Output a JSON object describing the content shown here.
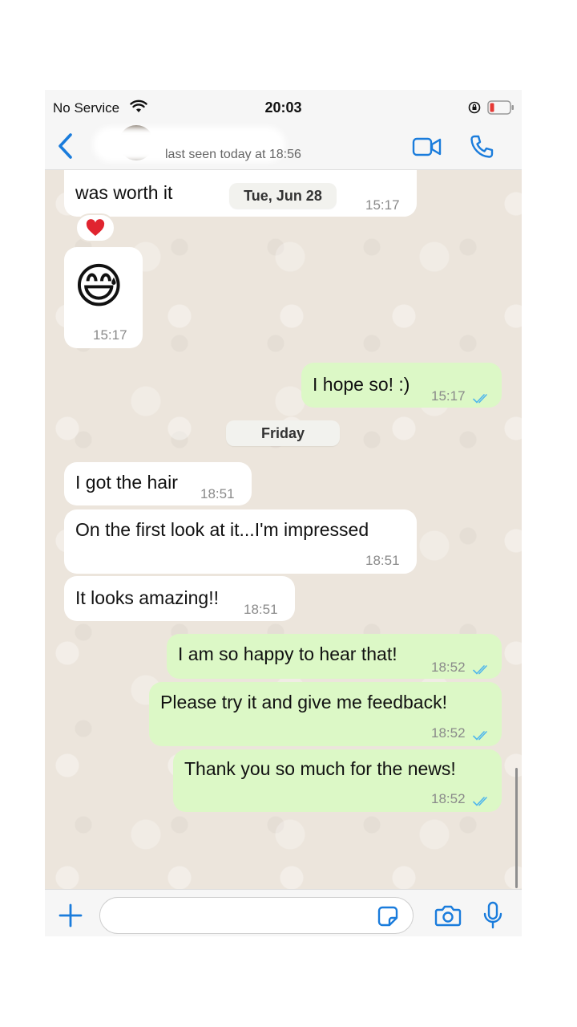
{
  "status_bar": {
    "carrier": "No Service",
    "time": "20:03"
  },
  "header": {
    "last_seen": "last seen today at 18:56"
  },
  "messages": [
    {
      "dir": "in",
      "text": "I got a bit upset , but I hope the wait was worth it",
      "visible_line": "was worth it",
      "time": "15:17"
    },
    {
      "dir": "in",
      "emoji": "😅",
      "time": "15:17"
    },
    {
      "dir": "out",
      "text": "I hope so! :)",
      "time": "15:17"
    },
    {
      "dir": "in",
      "text": "I got the hair",
      "time": "18:51"
    },
    {
      "dir": "in",
      "text": "On the first look at it...I'm impressed",
      "time": "18:51"
    },
    {
      "dir": "in",
      "text": "It looks amazing!!",
      "time": "18:51"
    },
    {
      "dir": "out",
      "text": "I am so happy to hear that!",
      "time": "18:52"
    },
    {
      "dir": "out",
      "text": "Please try it and give me feedback!",
      "time": "18:52"
    },
    {
      "dir": "out",
      "text": "Thank you so much for the news!",
      "time": "18:52"
    }
  ],
  "date_separators": [
    "Tue, Jun 28",
    "Friday"
  ],
  "reaction": "❤️",
  "input": {
    "placeholder": ""
  },
  "colors": {
    "accent": "#1a7cdc",
    "outgoing_bubble": "#dcf8c6",
    "incoming_bubble": "#ffffff",
    "chat_background": "#ece5dc",
    "read_check": "#4fb6ec"
  },
  "icons": [
    "wifi-icon",
    "lock-rotation-icon",
    "battery-icon",
    "back-chevron-icon",
    "video-call-icon",
    "phone-icon",
    "plus-icon",
    "sticker-icon",
    "camera-icon",
    "microphone-icon",
    "double-check-icon",
    "heart-icon"
  ]
}
